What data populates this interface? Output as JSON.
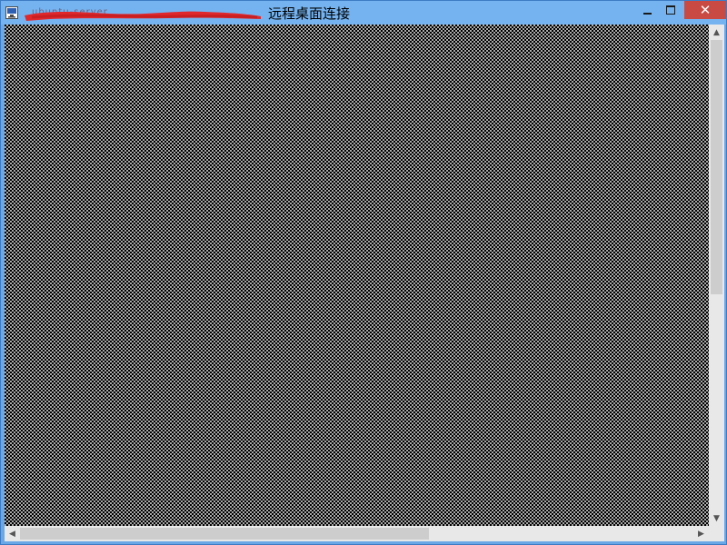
{
  "window": {
    "title": "远程桌面连接",
    "redacted_title_fragment": "ubuntu-server",
    "controls": {
      "minimize": "minimize",
      "maximize": "maximize",
      "close": "close"
    }
  },
  "icons": {
    "app": "remote-desktop-icon",
    "minimize": "minimize-icon",
    "maximize": "maximize-icon",
    "close": "close-icon",
    "scroll_up": "chevron-up-icon",
    "scroll_down": "chevron-down-icon",
    "scroll_left": "chevron-left-icon",
    "scroll_right": "chevron-right-icon"
  },
  "glyphs": {
    "close": "✕",
    "scroll_up": "▲",
    "scroll_down": "▼",
    "scroll_left": "◀",
    "scroll_right": "▶"
  },
  "colors": {
    "titlebar": "#74b3f0",
    "close_button": "#c94a43",
    "redaction": "#e0272b",
    "desktop_dither_light": "#aaaaaa",
    "desktop_dither_dark": "#000000"
  },
  "scroll": {
    "vertical_position": 0.0,
    "horizontal_position": 0.0
  }
}
